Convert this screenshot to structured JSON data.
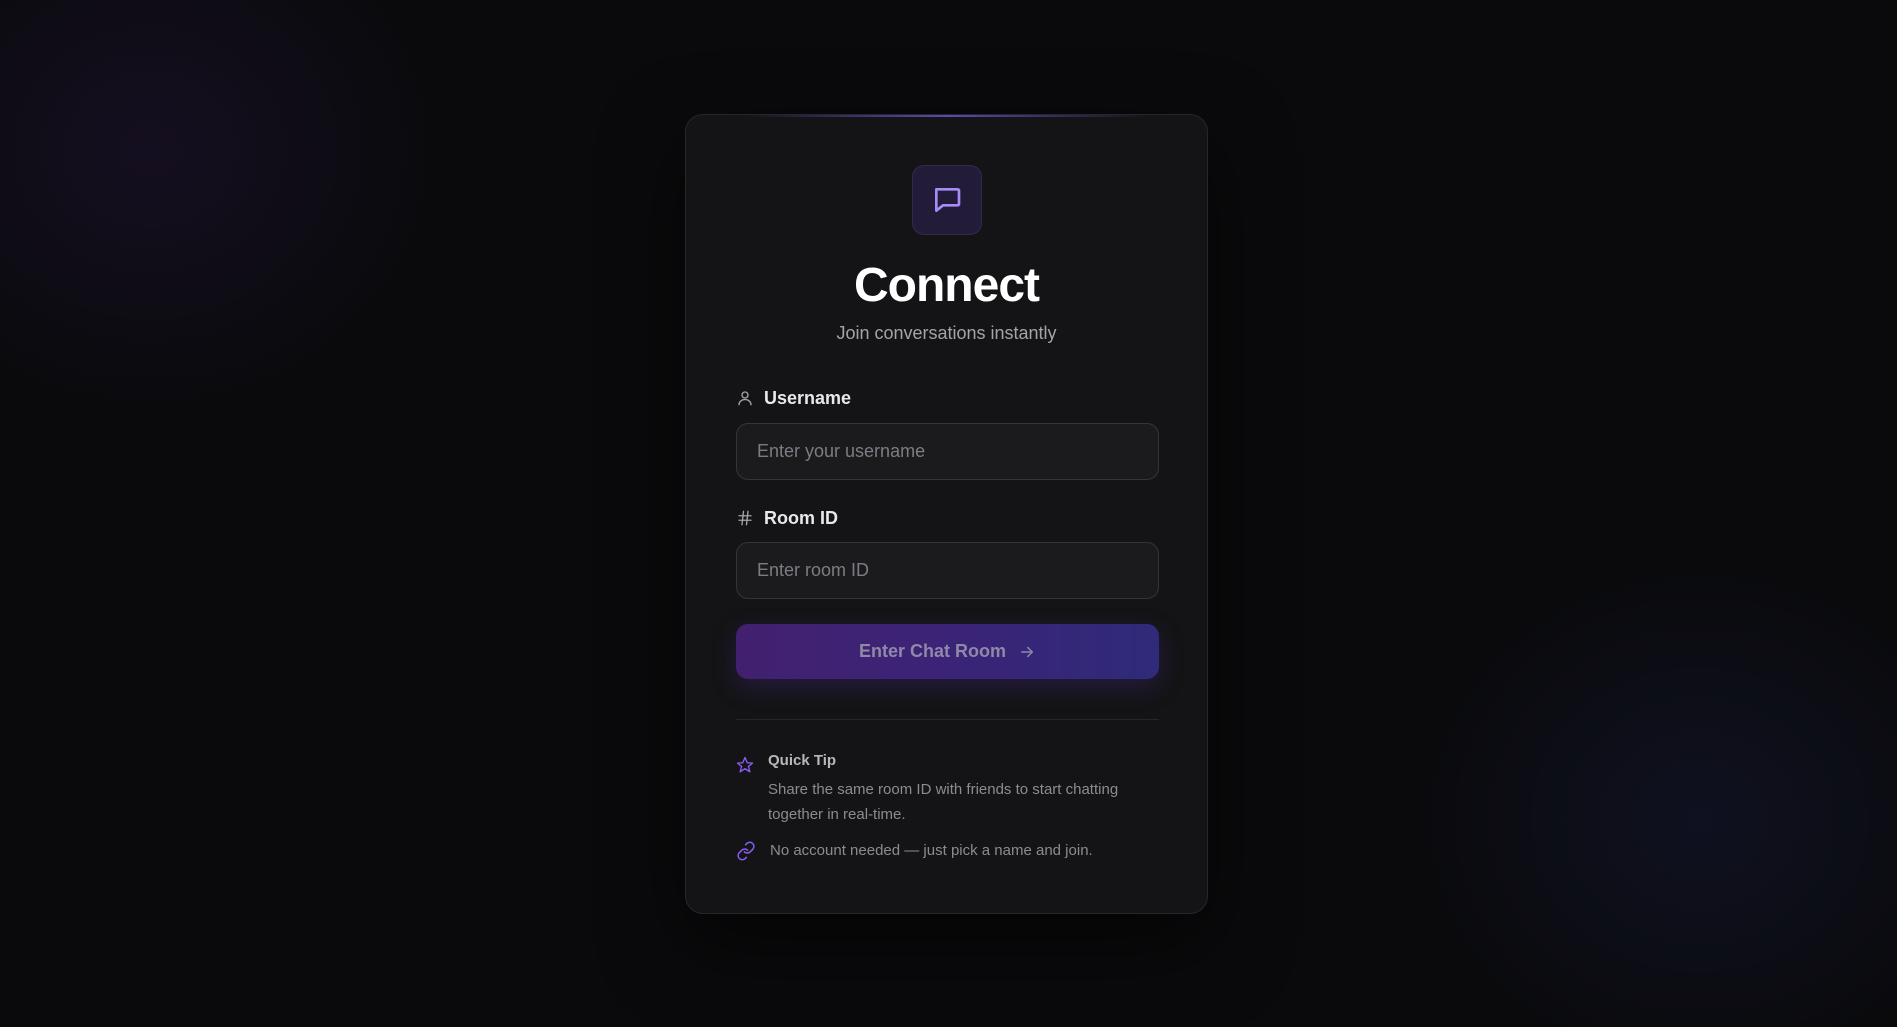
{
  "app": {
    "title": "Connect",
    "subtitle": "Join conversations instantly",
    "logo_icon": "chat-bubble-icon"
  },
  "form": {
    "username": {
      "label": "Username",
      "icon": "user-icon",
      "value": "",
      "placeholder": "Enter your username"
    },
    "room": {
      "label": "Room ID",
      "icon": "hash-icon",
      "value": "",
      "placeholder": "Enter room ID"
    },
    "submit": {
      "label": "Enter Chat Room",
      "icon": "arrow-right-icon"
    }
  },
  "tips": {
    "quick_tip": {
      "icon": "star-icon",
      "title": "Quick Tip",
      "body": "Share the same room ID with friends to start chatting together in real-time."
    },
    "note": {
      "icon": "link-icon",
      "text": "No account needed — just pick a name and join."
    }
  },
  "colors": {
    "background": "#0a0a0c",
    "card": "#141416",
    "accent": "#8b5cf6",
    "button_start": "#43206f",
    "button_end": "#2f2a7a"
  }
}
